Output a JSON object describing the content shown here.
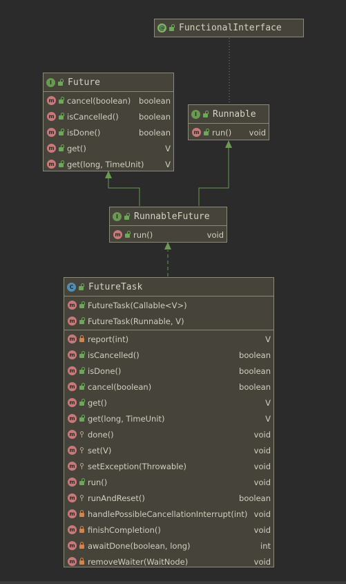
{
  "colors": {
    "background": "#2b2b2b",
    "node_fill": "#45433a",
    "node_border": "#8c8c7a",
    "edge_realization": "#6a9a52",
    "edge_dotted": "#8c8c7a"
  },
  "nodes": {
    "functional_interface": {
      "kind": "@",
      "name": "FunctionalInterface"
    },
    "future": {
      "kind": "I",
      "name": "Future",
      "methods": [
        {
          "sig": "cancel(boolean)",
          "ret": "boolean",
          "vis": "public"
        },
        {
          "sig": "isCancelled()",
          "ret": "boolean",
          "vis": "public"
        },
        {
          "sig": "isDone()",
          "ret": "boolean",
          "vis": "public"
        },
        {
          "sig": "get()",
          "ret": "V",
          "vis": "public"
        },
        {
          "sig": "get(long, TimeUnit)",
          "ret": "V",
          "vis": "public"
        }
      ]
    },
    "runnable": {
      "kind": "I",
      "name": "Runnable",
      "methods": [
        {
          "sig": "run()",
          "ret": "void",
          "vis": "public"
        }
      ]
    },
    "runnable_future": {
      "kind": "I",
      "name": "RunnableFuture",
      "methods": [
        {
          "sig": "run()",
          "ret": "void",
          "vis": "public"
        }
      ]
    },
    "future_task": {
      "kind": "C",
      "name": "FutureTask",
      "constructors": [
        {
          "sig": "FutureTask(Callable<V>)",
          "ret": "",
          "vis": "public"
        },
        {
          "sig": "FutureTask(Runnable, V)",
          "ret": "",
          "vis": "public"
        }
      ],
      "methods": [
        {
          "sig": "report(int)",
          "ret": "V",
          "vis": "private"
        },
        {
          "sig": "isCancelled()",
          "ret": "boolean",
          "vis": "public"
        },
        {
          "sig": "isDone()",
          "ret": "boolean",
          "vis": "public"
        },
        {
          "sig": "cancel(boolean)",
          "ret": "boolean",
          "vis": "public"
        },
        {
          "sig": "get()",
          "ret": "V",
          "vis": "public"
        },
        {
          "sig": "get(long, TimeUnit)",
          "ret": "V",
          "vis": "public"
        },
        {
          "sig": "done()",
          "ret": "void",
          "vis": "protected"
        },
        {
          "sig": "set(V)",
          "ret": "void",
          "vis": "protected"
        },
        {
          "sig": "setException(Throwable)",
          "ret": "void",
          "vis": "protected"
        },
        {
          "sig": "run()",
          "ret": "void",
          "vis": "public"
        },
        {
          "sig": "runAndReset()",
          "ret": "boolean",
          "vis": "protected"
        },
        {
          "sig": "handlePossibleCancellationInterrupt(int)",
          "ret": "void",
          "vis": "private"
        },
        {
          "sig": "finishCompletion()",
          "ret": "void",
          "vis": "private"
        },
        {
          "sig": "awaitDone(boolean, long)",
          "ret": "int",
          "vis": "private"
        },
        {
          "sig": "removeWaiter(WaitNode)",
          "ret": "void",
          "vis": "private"
        }
      ]
    }
  }
}
